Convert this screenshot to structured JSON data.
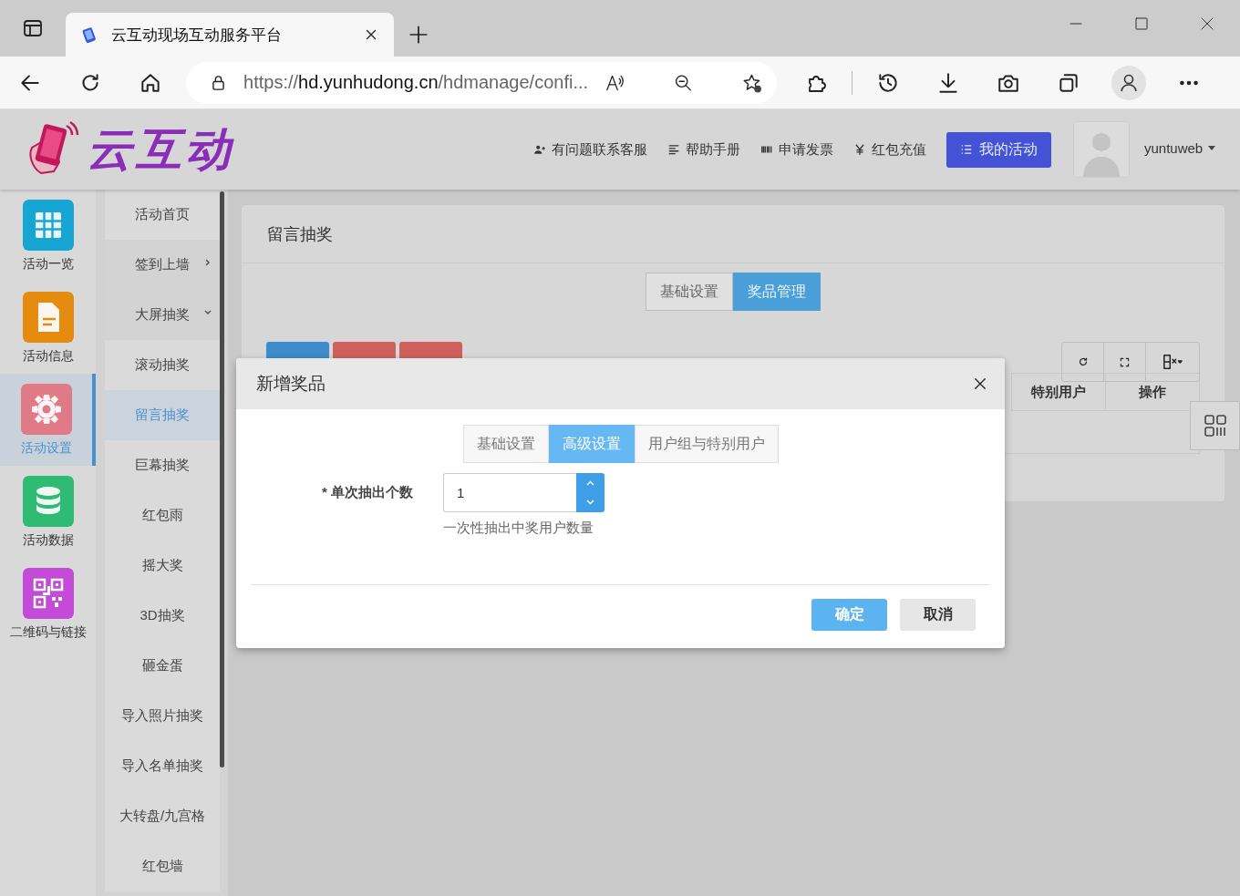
{
  "browser": {
    "tab_title": "云互动现场互动服务平台",
    "url_scheme": "https://",
    "url_host": "hd.yunhudong.cn",
    "url_path": "/hdmanage/confi..."
  },
  "header": {
    "logo": "云互动",
    "links": [
      "有问题联系客服",
      "帮助手册",
      "申请发票",
      "红包充值"
    ],
    "primary_button": "我的活动",
    "user": "yuntuweb"
  },
  "nav": [
    {
      "label": "活动一览",
      "color": "#17a6d4",
      "selected": false
    },
    {
      "label": "活动信息",
      "color": "#e48b10",
      "selected": false
    },
    {
      "label": "活动设置",
      "color": "#e07a86",
      "selected": true
    },
    {
      "label": "活动数据",
      "color": "#2fbb74",
      "selected": false
    },
    {
      "label": "二维码与链接",
      "color": "#c44bd8",
      "selected": false
    }
  ],
  "submenu": [
    {
      "label": "活动首页",
      "selected": false
    },
    {
      "label": "签到上墙",
      "selected": false,
      "expanded": false
    },
    {
      "label": "大屏抽奖",
      "selected": false,
      "expanded": true,
      "children": [
        {
          "label": "滚动抽奖",
          "selected": false
        },
        {
          "label": "留言抽奖",
          "selected": true
        },
        {
          "label": "巨幕抽奖",
          "selected": false
        },
        {
          "label": "红包雨",
          "selected": false
        },
        {
          "label": "摇大奖",
          "selected": false
        },
        {
          "label": "3D抽奖",
          "selected": false
        },
        {
          "label": "砸金蛋",
          "selected": false
        },
        {
          "label": "导入照片抽奖",
          "selected": false
        },
        {
          "label": "导入名单抽奖",
          "selected": false
        },
        {
          "label": "大转盘/九宫格",
          "selected": false
        },
        {
          "label": "红包墙",
          "selected": false
        }
      ]
    }
  ],
  "panel": {
    "title": "留言抽奖",
    "tabs": [
      {
        "label": "基础设置",
        "selected": false
      },
      {
        "label": "奖品管理",
        "selected": true
      }
    ],
    "action_buttons": [
      {
        "kind": "add"
      },
      {
        "kind": "delete"
      },
      {
        "kind": "clear"
      }
    ],
    "table": {
      "columns": [
        "特别用户",
        "操作"
      ]
    }
  },
  "modal": {
    "title": "新增奖品",
    "tabs": [
      {
        "label": "基础设置",
        "selected": false
      },
      {
        "label": "高级设置",
        "selected": true
      },
      {
        "label": "用户组与特别用户",
        "selected": false
      }
    ],
    "field": {
      "label": "* 单次抽出个数",
      "value": "1",
      "hint": "一次性抽出中奖用户数量"
    },
    "buttons": [
      {
        "label": "确定",
        "kind": "primary"
      },
      {
        "label": "取消",
        "kind": "default"
      }
    ]
  }
}
